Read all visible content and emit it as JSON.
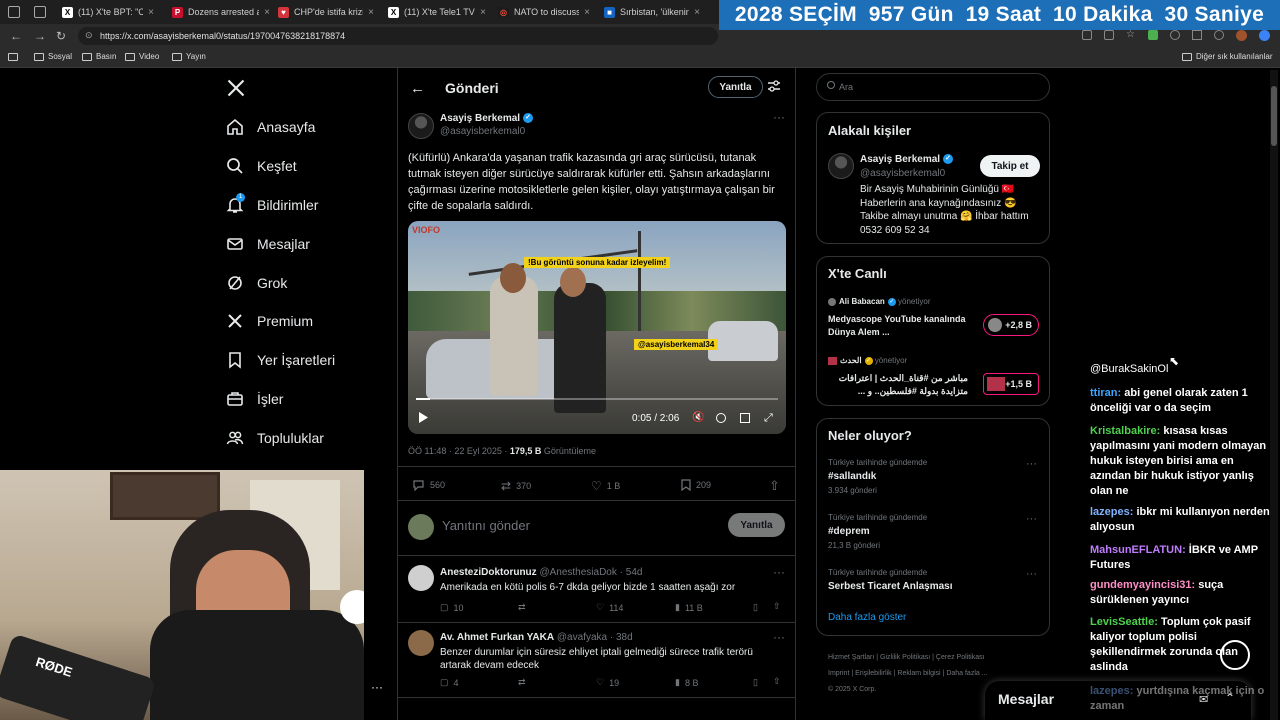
{
  "browser": {
    "tabs": [
      {
        "label": "(11) X'te BPT: \"Can"
      },
      {
        "label": "Dozens arrested ar"
      },
      {
        "label": "CHP'de istifa krizi:"
      },
      {
        "label": "(11) X'te Tele1 TV:"
      },
      {
        "label": "NATO to discuss R"
      },
      {
        "label": "Sırbistan, 'ülkenin"
      }
    ],
    "url": "https://x.com/asayisberkemal0/status/1970047638218178874",
    "bookmarks": [
      "Sosyal",
      "Basın",
      "Video",
      "Yayın"
    ],
    "other_bookmarks": "Diğer sık kullanılanlar"
  },
  "countdown": [
    "2028 SEÇİM",
    "957 Gün",
    "19 Saat",
    "10 Dakika",
    "30 Saniye"
  ],
  "nav": [
    {
      "label": "Anasayfa",
      "icon": "home-icon"
    },
    {
      "label": "Keşfet",
      "icon": "search-icon"
    },
    {
      "label": "Bildirimler",
      "icon": "bell-icon",
      "badge": "1"
    },
    {
      "label": "Mesajlar",
      "icon": "mail-icon"
    },
    {
      "label": "Grok",
      "icon": "grok-icon"
    },
    {
      "label": "Premium",
      "icon": "x-icon"
    },
    {
      "label": "Yer İşaretleri",
      "icon": "bookmark-icon"
    },
    {
      "label": "İşler",
      "icon": "briefcase-icon"
    },
    {
      "label": "Topluluklar",
      "icon": "people-icon"
    }
  ],
  "header": {
    "title": "Gönderi",
    "reply_btn": "Yanıtla"
  },
  "post": {
    "name": "Asayiş Berkemal",
    "handle": "@asayisberkemal0",
    "text": "(Küfürlü) Ankara'da yaşanan trafik kazasında gri araç sürücüsü, tutanak tutmak isteyen diğer sürücüye saldırarak küfürler etti. Şahsın arkadaşlarını çağırması üzerine motosikletlerle gelen kişiler, olayı yatıştırmaya çalışan bir çifte de sopalarla saldırdı.",
    "video_caption": "!Bu görüntü sonuna kadar izleyelim!",
    "video_watermark": "@asayisberkemal34",
    "video_time": "0:05 / 2:06",
    "video_progress": 0.04,
    "meta_time": "ÖÖ 11:48 · 22 Eyl 2025 · ",
    "views": "179,5 B",
    "views_label": " Görüntüleme",
    "stats": {
      "replies": "560",
      "reposts": "370",
      "likes": "1 B",
      "bookmarks": "209"
    },
    "reply_placeholder": "Yanıtını gönder",
    "reply_button": "Yanıtla"
  },
  "replies": [
    {
      "name": "AnesteziDoktorunuz",
      "handle": "@AnesthesiaDok · 54d",
      "text": "Amerikada en kötü polis 6-7 dkda geliyor bizde 1 saatten aşağı zor",
      "replies": "10",
      "likes": "114",
      "views": "11 B"
    },
    {
      "name": "Av. Ahmet Furkan YAKA",
      "handle": "@avafyaka · 38d",
      "text": "Benzer durumlar için süresiz ehliyet iptali gelmediği sürece trafik terörü artarak devam edecek",
      "replies": "4",
      "likes": "19",
      "views": "8 B"
    }
  ],
  "search": {
    "placeholder": "Ara"
  },
  "related": {
    "title": "Alakalı kişiler",
    "name": "Asayiş Berkemal",
    "handle": "@asayisberkemal0",
    "follow": "Takip et",
    "bio": "Bir Asayiş Muhabirinin Günlüğü 🇹🇷 Haberlerin ana kaynağındasınız 😎 Takibe almayı unutma 🤗 İhbar hattım 0532 609 52 34"
  },
  "live": {
    "title": "X'te Canlı",
    "items": [
      {
        "host": "Ali Babacan",
        "status": "yönetiyor",
        "text": "Medyascope YouTube kanalında Dünya Alem ...",
        "count": "+2,8 B"
      },
      {
        "host": "الحدث",
        "status": "yönetiyor",
        "text": "مباشر من #قناة_الحدث | اعترافات متزايدة بدولة #فلسطين.. و ...",
        "count": "+1,5 B"
      }
    ]
  },
  "trends": {
    "title": "Neler oluyor?",
    "items": [
      {
        "context": "Türkiye tarihinde gündemde",
        "name": "#sallandık",
        "count": "3.934 gönderi"
      },
      {
        "context": "Türkiye tarihinde gündemde",
        "name": "#deprem",
        "count": "21,3 B gönderi"
      },
      {
        "context": "Türkiye tarihinde gündemde",
        "name": "Serbest Ticaret Anlaşması",
        "count": ""
      }
    ],
    "more": "Daha fazla göster"
  },
  "footer": {
    "links1": [
      "Hizmet Şartları",
      "Gizlilik Politikası",
      "Çerez Politikası"
    ],
    "links2": [
      "Imprint",
      "Erişilebilirlik",
      "Reklam bilgisi",
      "Daha fazla ..."
    ],
    "copyright": "© 2025 X Corp."
  },
  "messages_drawer": {
    "title": "Mesajlar"
  },
  "chat": [
    {
      "user": "",
      "text": "@BurakSakinOl",
      "color": "#ffffff"
    },
    {
      "user": "ttiran:",
      "text": " abi genel olarak zaten 1 önceliği var o da seçim",
      "color": "#3ea6ff"
    },
    {
      "user": "Kristalbakire:",
      "text": " kısasa kısas yapılmasını yani modern olmayan hukuk isteyen birisi ama en azından bir hukuk istiyor yanlış olan ne",
      "color": "#4fd14f"
    },
    {
      "user": "lazepes:",
      "text": " ibkr mi kullanıyon nerden alıyosun",
      "color": "#7fb2ff"
    },
    {
      "user": "MahsunEFLATUN:",
      "text": " İBKR ve AMP Futures",
      "color": "#c07cff"
    },
    {
      "user": "gundemyayincisi31:",
      "text": " suça sürüklenen yayıncı",
      "color": "#ff8fc8"
    },
    {
      "user": "LevisSeattle:",
      "text": " Toplum çok pasif kaliyor toplum polisi şekillendirmek zorunda olan aslinda",
      "color": "#4fd14f"
    },
    {
      "user": "lazepes:",
      "text": " yurtdışına kaçmak için o zaman",
      "color": "#7fb2ff"
    }
  ],
  "webcam": {
    "mic_label": "RØDE"
  }
}
